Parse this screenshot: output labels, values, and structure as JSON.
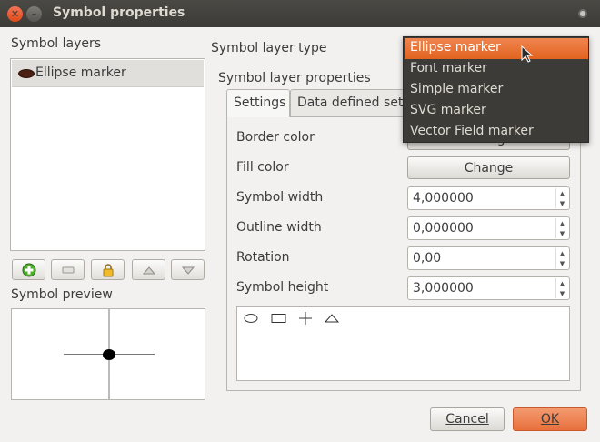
{
  "window": {
    "title": "Symbol properties"
  },
  "left": {
    "layers_label": "Symbol layers",
    "layers": [
      {
        "label": "Ellipse marker"
      }
    ],
    "preview_label": "Symbol preview"
  },
  "right": {
    "layer_type_label": "Symbol layer type",
    "layer_props_label": "Symbol layer properties",
    "tabs": [
      {
        "label": "Settings"
      },
      {
        "label": "Data defined settings"
      }
    ],
    "fields": {
      "border_color": {
        "label": "Border color",
        "button": "Change"
      },
      "fill_color": {
        "label": "Fill color",
        "button": "Change"
      },
      "symbol_width": {
        "label": "Symbol width",
        "value": "4,000000"
      },
      "outline_width": {
        "label": "Outline width",
        "value": "0,000000"
      },
      "rotation": {
        "label": "Rotation",
        "value": "0,00"
      },
      "symbol_height": {
        "label": "Symbol height",
        "value": "3,000000"
      }
    }
  },
  "dropdown": {
    "selected": "Ellipse marker",
    "options": [
      "Ellipse marker",
      "Font marker",
      "Simple marker",
      "SVG marker",
      "Vector Field marker"
    ]
  },
  "buttons": {
    "cancel": "Cancel",
    "ok": "OK"
  },
  "colors": {
    "accent": "#e8703c",
    "titlebar": "#3c3b37"
  }
}
